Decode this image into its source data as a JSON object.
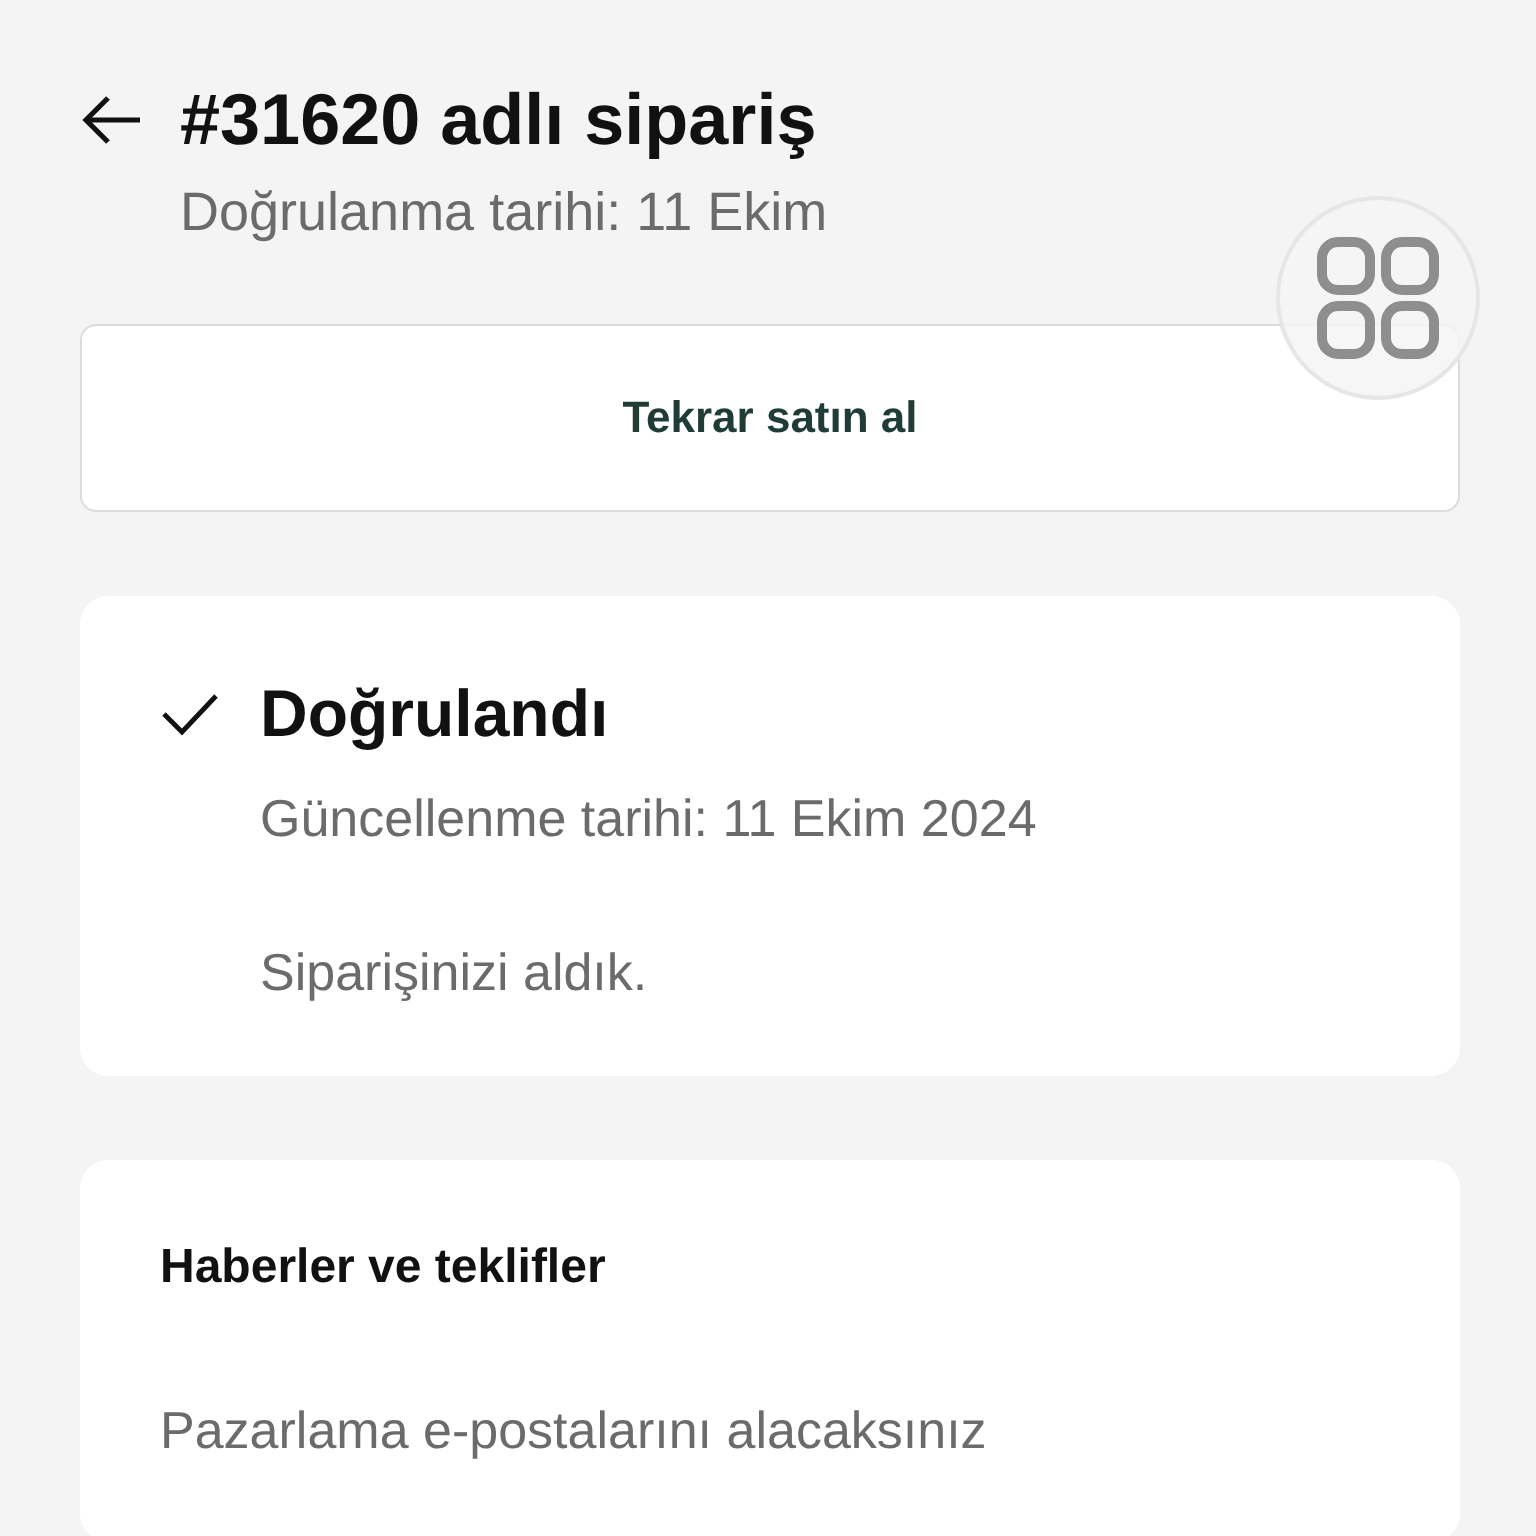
{
  "header": {
    "title": "#31620 adlı sipariş",
    "subtitle": "Doğrulanma tarihi: 11 Ekim"
  },
  "buy_again": {
    "label": "Tekrar satın al"
  },
  "status": {
    "title": "Doğrulandı",
    "updated": "Güncellenme tarihi: 11 Ekim 2024",
    "message": "Siparişinizi aldık.",
    "checked": true
  },
  "news": {
    "title": "Haberler ve teklifler",
    "body": "Pazarlama e-postalarını alacaksınız"
  }
}
